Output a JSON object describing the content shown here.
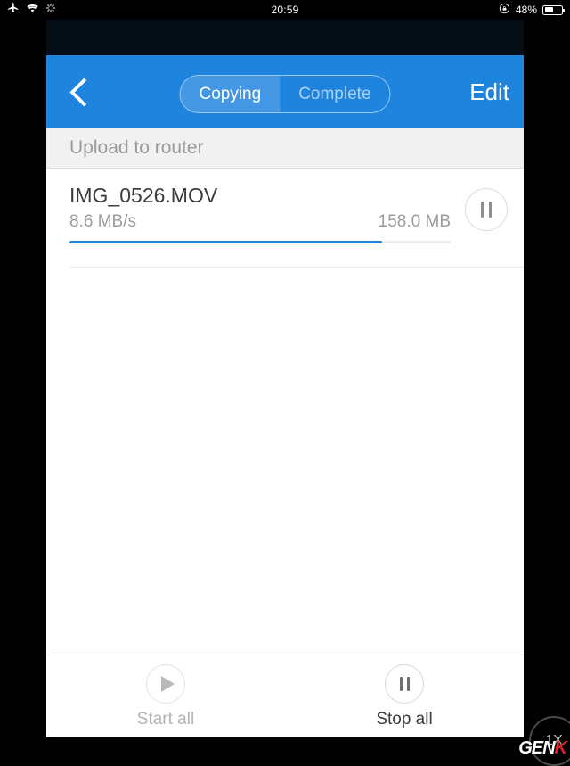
{
  "statusbar": {
    "time": "20:59",
    "battery_percent": "48%",
    "icons": {
      "airplane": "airplane-mode-icon",
      "wifi": "wifi-icon",
      "activity": "activity-spinner-icon",
      "rotation_lock": "rotation-lock-icon",
      "battery": "battery-icon"
    }
  },
  "navbar": {
    "back_label": "back-chevron",
    "segments": [
      {
        "label": "Copying",
        "selected": true
      },
      {
        "label": "Complete",
        "selected": false
      }
    ],
    "edit_label": "Edit",
    "background_color": "#1f84de"
  },
  "section": {
    "header": "Upload to router"
  },
  "transfers": [
    {
      "name": "IMG_0526.MOV",
      "speed": "8.6 MB/s",
      "size": "158.0 MB",
      "progress_percent": 82,
      "action": "pause-icon"
    }
  ],
  "toolbar": {
    "start_all_label": "Start all",
    "stop_all_label": "Stop all",
    "start_icon": "play-icon",
    "stop_icon": "pause-icon"
  },
  "overlay": {
    "zoom_badge": "1X",
    "watermark_prefix": "GEN",
    "watermark_suffix": "K"
  }
}
